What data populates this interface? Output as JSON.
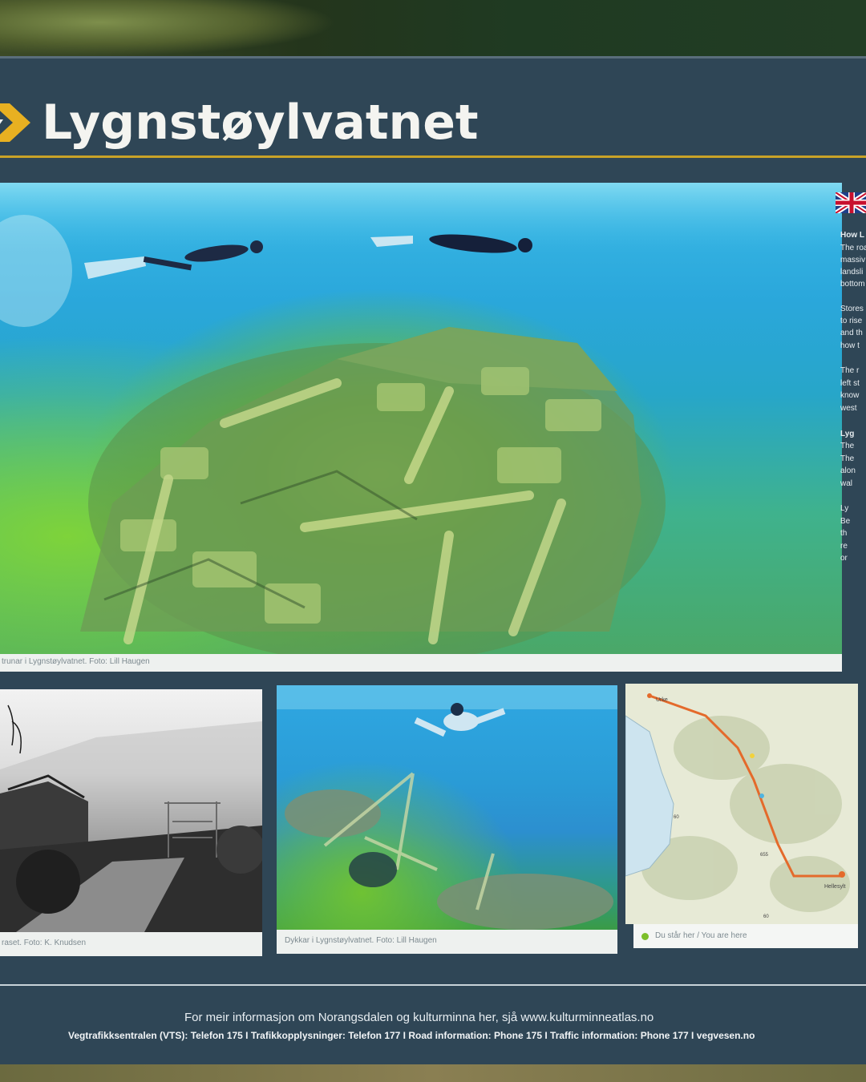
{
  "sign": {
    "title": "Lygnstøylvatnet",
    "brand_color": "#c9a227",
    "panel_color": "#2f4656"
  },
  "photos": {
    "main_caption": "trunar i Lygnstøylvatnet. Foto: Lill Haugen",
    "bw_caption": "raset. Foto: K. Knudsen",
    "diver_caption": "Dykkar i Lygnstøylvatnet. Foto: Lill Haugen",
    "map_caption": "Du står her / You are here",
    "map_labels": [
      "Urke",
      "Hellesylt",
      "655",
      "60",
      "60"
    ]
  },
  "english_text": {
    "lines": [
      "How L",
      "The roa",
      "massiv",
      "landsli",
      "bottom",
      "Stores",
      "to rise",
      "and th",
      "how t",
      "The r",
      "left st",
      "know",
      "west",
      "Lyg",
      "The",
      "The",
      "alon",
      "wal",
      "Ly",
      "Be",
      "th",
      "re",
      "or"
    ]
  },
  "footer": {
    "info_line": "For meir informasjon om Norangsdalen og kulturminna her, sjå www.kulturminneatlas.no",
    "contact_line": "Vegtrafikksentralen (VTS): Telefon 175 I Trafikkopplysninger: Telefon 177 I Road information: Phone 175 I Traffic information: Phone 177 I vegvesen.no"
  }
}
